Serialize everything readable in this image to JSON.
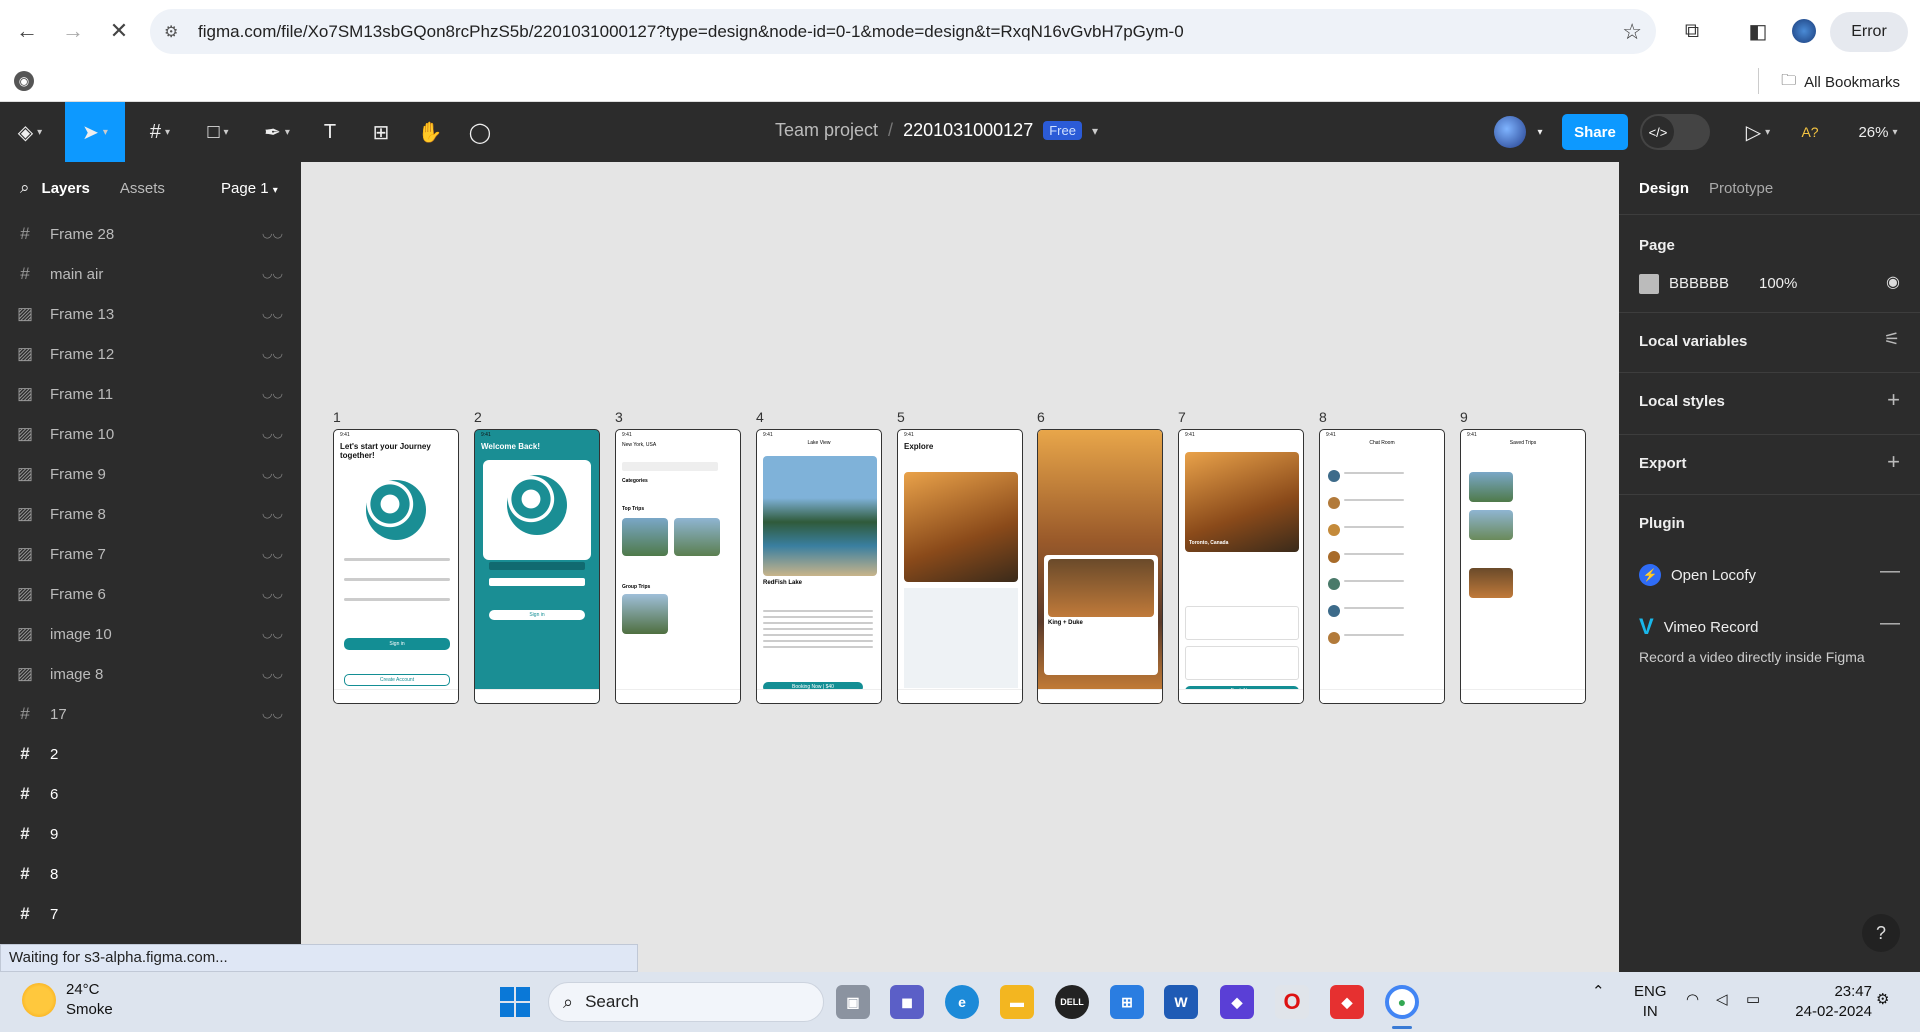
{
  "browser": {
    "url": "figma.com/file/Xo7SM13sbGQon8rcPhzS5b/2201031000127?type=design&node-id=0-1&mode=design&t=RxqN16vGvbH7pGym-0",
    "error_label": "Error",
    "all_bookmarks": "All Bookmarks"
  },
  "figma": {
    "project": "Team project",
    "file_name": "2201031000127",
    "plan_badge": "Free",
    "share": "Share",
    "zoom": "26%",
    "a_label": "A?"
  },
  "left_panel": {
    "tab_layers": "Layers",
    "tab_assets": "Assets",
    "page": "Page 1",
    "layers": [
      {
        "name": "Frame 28",
        "icon": "frame-icon"
      },
      {
        "name": "main air",
        "icon": "frame-icon"
      },
      {
        "name": "Frame 13",
        "icon": "image-icon"
      },
      {
        "name": "Frame 12",
        "icon": "image-icon"
      },
      {
        "name": "Frame 11",
        "icon": "image-icon"
      },
      {
        "name": "Frame 10",
        "icon": "image-icon"
      },
      {
        "name": "Frame 9",
        "icon": "image-icon"
      },
      {
        "name": "Frame 8",
        "icon": "image-icon"
      },
      {
        "name": "Frame 7",
        "icon": "image-icon"
      },
      {
        "name": "Frame 6",
        "icon": "image-icon"
      },
      {
        "name": "image 10",
        "icon": "image-icon"
      },
      {
        "name": "image 8",
        "icon": "image-icon"
      },
      {
        "name": "17",
        "icon": "frame-icon"
      },
      {
        "name": "2",
        "icon": "frame-icon"
      },
      {
        "name": "6",
        "icon": "frame-icon"
      },
      {
        "name": "9",
        "icon": "frame-icon"
      },
      {
        "name": "8",
        "icon": "frame-icon"
      },
      {
        "name": "7",
        "icon": "frame-icon"
      }
    ]
  },
  "canvas": {
    "frame_labels": [
      "1",
      "2",
      "3",
      "4",
      "5",
      "6",
      "7",
      "8",
      "9"
    ],
    "frames": {
      "f1_title": "Let's start your Journey together!",
      "f1_btn": "Sign in",
      "f1_btn2": "Create Account",
      "f2_title": "Welcome Back!",
      "f2_btn": "Sign in",
      "f3_location": "New York, USA",
      "f3_categories": "Categories",
      "f3_top": "Top Trips",
      "f3_group": "Group Trips",
      "f4_header": "Lake View",
      "f4_name": "RedFish Lake",
      "f4_btn": "Booking Now | $40",
      "f5_title": "Explore",
      "f6_name": "King + Duke",
      "f7_city": "Toronto, Canada",
      "f7_btn": "Book Now",
      "f8_header": "Chat Room",
      "f9_header": "Saved Trips"
    }
  },
  "status_text": "Waiting for s3-alpha.figma.com...",
  "right_panel": {
    "tab_design": "Design",
    "tab_prototype": "Prototype",
    "page_heading": "Page",
    "page_color": "BBBBBB",
    "page_opacity": "100%",
    "local_variables": "Local variables",
    "local_styles": "Local styles",
    "export": "Export",
    "plugin": "Plugin",
    "plugins": [
      "Open Locofy",
      "Vimeo Record"
    ],
    "vimeo_desc": "Record a video directly inside Figma",
    "help": "?"
  },
  "taskbar": {
    "temp": "24°C",
    "weather": "Smoke",
    "search": "Search",
    "lang1": "ENG",
    "lang2": "IN",
    "time": "23:47",
    "date": "24-02-2024"
  }
}
